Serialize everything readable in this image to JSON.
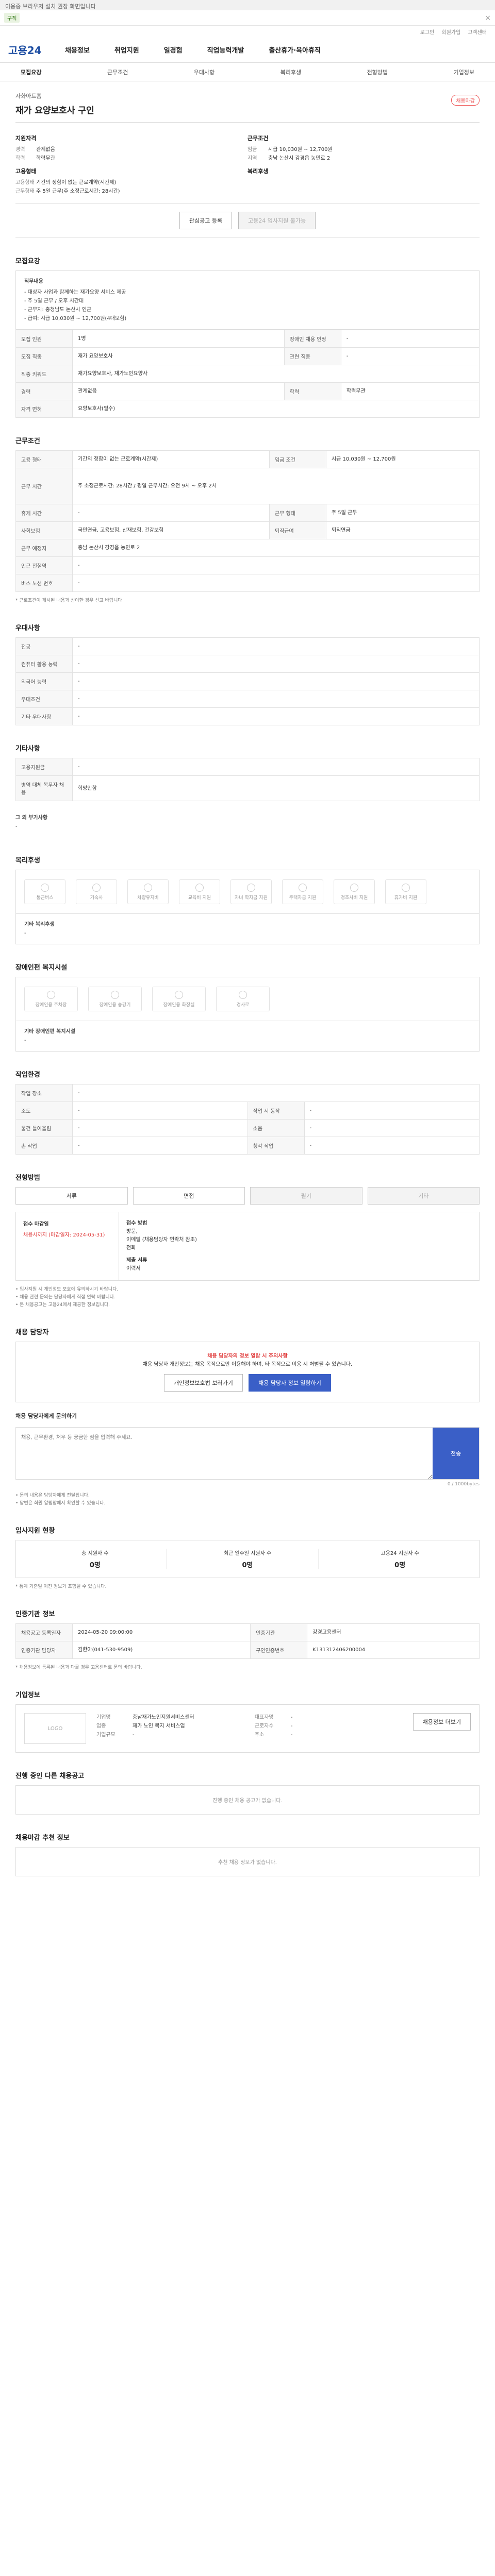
{
  "notice": "이용중 브라우저 설치 권장 화면입니다",
  "topbar": {
    "tag": "구직",
    "close": "×"
  },
  "util": [
    "로그인",
    "회원가입",
    "고객센터"
  ],
  "header": {
    "logo": "고용24",
    "gnb": [
      "채용정보",
      "취업지원",
      "일경험",
      "직업능력개발",
      "출산휴가·육아휴직"
    ]
  },
  "subnav": [
    "모집요강",
    "근무조건",
    "우대사항",
    "복리후생",
    "전형방법",
    "기업정보"
  ],
  "hero": {
    "company": "자화아트홈",
    "title": "재가 요양보호사 구인",
    "badge": "채용마감"
  },
  "summary": {
    "left_title": "지원자격",
    "left": [
      [
        "경력",
        "관계없음"
      ],
      [
        "학력",
        "학력무관"
      ]
    ],
    "left_title2": "고용형태",
    "left2": [
      [
        "고용형태",
        "기간의 정함이 없는 근로계약(시간제)"
      ],
      [
        "근무형태",
        "주 5일 근무(주 소정근로시간: 28시간)"
      ]
    ],
    "right_title": "근무조건",
    "right": [
      [
        "임금",
        "시급 10,030원 ~ 12,700원"
      ],
      [
        "지역",
        "충남 논산시 강경읍 농민로 2"
      ]
    ],
    "right_title2": "복리후생"
  },
  "actions": {
    "like": "관심공고 등록",
    "apply": "고용24 입사지원 불가능"
  },
  "recruit": {
    "title": "모집요강",
    "duty_label": "직무내용",
    "duty": [
      "- 대상자 사업과 함께하는 재가요양 서비스 제공",
      "- 주 5일 근무 / 오후 시간대",
      "- 근무지: 충청남도 논산시 인근",
      "- 급여: 시급 10,030원 ~ 12,700원(4대보험)"
    ],
    "rows": [
      [
        "모집 인원",
        "1명",
        "장애인 채용 인정",
        "-"
      ],
      [
        "모집 직종",
        "재가 요양보호사",
        "관련 직종",
        "-"
      ],
      [
        "직종 키워드",
        "재가요양보호사, 재가노인요양사",
        "",
        ""
      ],
      [
        "경력",
        "관계없음",
        "학력",
        "학력무관"
      ],
      [
        "자격 면허",
        "요양보호사(필수)",
        "",
        ""
      ]
    ]
  },
  "condition": {
    "title": "근무조건",
    "rows": [
      [
        "고용 형태",
        "기간의 정함이 없는 근로계약(시간제)",
        "임금 조건",
        "시급 10,030원 ~ 12,700원"
      ],
      [
        "근무 시간",
        "주 소정근로시간: 28시간 / 평일 근무시간: 오전 9시 ~ 오후 2시",
        "",
        ""
      ],
      [
        "휴게 시간",
        "-",
        "근무 형태",
        "주 5일 근무"
      ],
      [
        "사회보험",
        "국민연금, 고용보험, 산재보험, 건강보험",
        "퇴직급여",
        "퇴직연금"
      ],
      [
        "근무 예정지",
        "충남 논산시 강경읍 농민로 2",
        "",
        ""
      ],
      [
        "인근 전철역",
        "-",
        "",
        ""
      ],
      [
        "버스 노선 번호",
        "-",
        "",
        ""
      ]
    ],
    "note": "* 근로조건이 게시된 내용과 상이한 경우 신고 바랍니다"
  },
  "preference": {
    "title": "우대사항",
    "rows": [
      [
        "전공",
        "-"
      ],
      [
        "컴퓨터 활용 능력",
        "-"
      ],
      [
        "외국어 능력",
        "-"
      ],
      [
        "우대조건",
        "-"
      ],
      [
        "기타 우대사항",
        "-"
      ]
    ]
  },
  "other": {
    "title": "기타사항",
    "rows": [
      [
        "고용지원금",
        "-"
      ],
      [
        "병역 대체 복무자 채용",
        "희망안함"
      ]
    ],
    "etc_label": "그 외 부가사항",
    "etc": "-"
  },
  "welfare": {
    "title": "복리후생",
    "items": [
      "통근버스",
      "기숙사",
      "차량유지비",
      "교육비 지원",
      "자녀 학자금 지원",
      "주택자금 지원",
      "경조사비 지원",
      "휴가비 지원"
    ],
    "etc_label": "기타 복리후생",
    "etc": "-"
  },
  "disability": {
    "title": "장애인편 복지시설",
    "items": [
      "장애인용 주차장",
      "장애인용 승강기",
      "장애인용 화장실",
      "경사로"
    ],
    "etc_label": "기타 장애인편 복지시설",
    "etc": "-"
  },
  "job_env": {
    "title": "작업환경",
    "rows": [
      [
        "작업 장소",
        "-",
        "",
        ""
      ],
      [
        "조도",
        "-",
        "작업 시 동작",
        "-"
      ],
      [
        "물건 들어올림",
        "-",
        "소음",
        "-"
      ],
      [
        "손 작업",
        "-",
        "청각 작업",
        "-"
      ]
    ]
  },
  "selection": {
    "title": "전형방법",
    "opts": [
      "서류",
      "면접",
      "필기",
      "기타"
    ],
    "deadline_label": "접수 마감일",
    "deadline": "채용시까지 (마감일자: 2024-05-31)",
    "method_label": "접수 방법",
    "methods": [
      "방문,",
      "이메일 (채용담당자 연락처 참조)",
      "전화"
    ],
    "doc_label": "제출 서류",
    "doc": "이력서",
    "notes": [
      "• 입사지원 시 개인정보 보호에 유의하시기 바랍니다.",
      "• 채용 관련 문의는 담당자에게 직접 연락 바랍니다.",
      "• 본 채용공고는 고용24에서 제공한 정보입니다."
    ]
  },
  "contact": {
    "title": "채용 담당자",
    "warn": "채용 담당자의 정보 열람 시 주의사항",
    "warn_text": "채용 담당자 개인정보는 채용 목적으로만 이용해야 하며, 타 목적으로 이용 시 처벌될 수 있습니다.",
    "btn_cancel": "개인정보보호법 보러가기",
    "btn_ok": "채용 담당자 정보 열람하기",
    "q_label": "채용 담당자에게 문의하기",
    "q_placeholder": "채용, 근무환경, 처우 등 궁금한 점을 입력해 주세요.",
    "q_send": "전송",
    "q_count": "0 / 1000bytes",
    "notes": [
      "• 문의 내용은 담당자에게 전달됩니다.",
      "• 답변은 회원 알림함에서 확인할 수 있습니다."
    ]
  },
  "stats": {
    "title": "입사지원 현황",
    "items": [
      [
        "총 지원자 수",
        "0명"
      ],
      [
        "최근 일주일 지원자 수",
        "0명"
      ],
      [
        "고용24 지원자 수",
        "0명"
      ]
    ],
    "note": "* 통계 기준일 이전 정보가 포함될 수 있습니다."
  },
  "info": {
    "title": "인증기관 정보",
    "rows": [
      [
        "채용공고 등록일자",
        "2024-05-20 09:00:00",
        "인증기관",
        "강경고용센터"
      ],
      [
        "인증기관 담당자",
        "김한아(041-530-9509)",
        "구인인증번호",
        "K131312406200004"
      ]
    ],
    "note": "* 채용정보에 등록된 내용과 다를 경우 고용센터로 문의 바랍니다."
  },
  "company": {
    "title": "기업정보",
    "logo": "LOGO",
    "rows": [
      [
        "기업명",
        "충남재가노인지원서비스센터"
      ],
      [
        "업종",
        "재가 노인 복지 서비스업"
      ],
      [
        "기업규모",
        "-"
      ]
    ],
    "rows2": [
      [
        "대표자명",
        "-"
      ],
      [
        "근로자수",
        "-"
      ],
      [
        "주소",
        "-"
      ]
    ],
    "btn": "채용정보 더보기"
  },
  "other_jobs": {
    "title": "진행 중인 다른 채용공고",
    "empty": "진행 중인 채용 공고가 없습니다."
  },
  "recommend": {
    "title": "채용마감 추천 정보",
    "empty": "추천 채용 정보가 없습니다."
  }
}
